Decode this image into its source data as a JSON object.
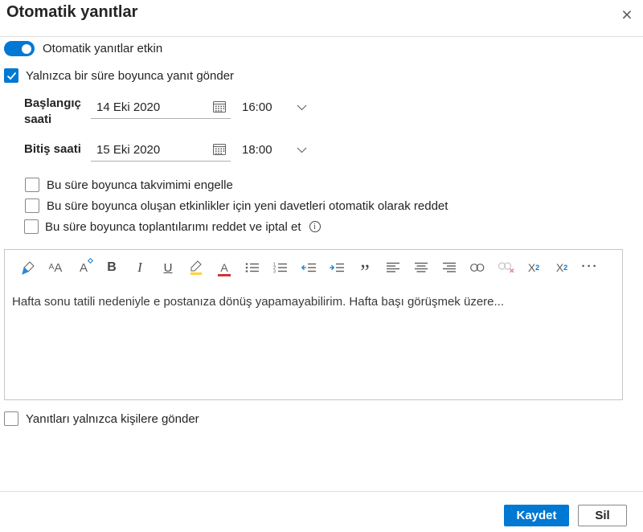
{
  "dialog": {
    "title": "Otomatik yanıtlar",
    "close_icon": "×"
  },
  "auto_reply_toggle": {
    "label": "Otomatik yanıtlar etkin",
    "state": "on"
  },
  "period_checkbox": {
    "label": "Yalnızca bir süre boyunca yanıt gönder",
    "checked": true
  },
  "schedule": {
    "start": {
      "label": "Başlangıç saati",
      "date": "14 Eki 2020",
      "time": "16:00"
    },
    "end": {
      "label": "Bitiş saati",
      "date": "15 Eki 2020",
      "time": "18:00"
    }
  },
  "options": [
    {
      "label": "Bu süre boyunca takvimimi engelle",
      "checked": false
    },
    {
      "label": "Bu süre boyunca oluşan etkinlikler için yeni davetleri otomatik olarak reddet",
      "checked": false
    },
    {
      "label": "Bu süre boyunca toplantılarımı reddet ve iptal et",
      "checked": false,
      "info": true
    }
  ],
  "editor": {
    "toolbar_icons": [
      "format-painter-icon",
      "font-name-icon",
      "font-size-icon",
      "bold-icon",
      "italic-icon",
      "underline-icon",
      "highlight-icon",
      "font-color-icon",
      "bullet-list-icon",
      "numbered-list-icon",
      "decrease-indent-icon",
      "increase-indent-icon",
      "quote-icon",
      "align-left-icon",
      "align-center-icon",
      "align-right-icon",
      "insert-link-icon",
      "remove-link-icon",
      "superscript-icon",
      "subscript-icon",
      "more-options-icon"
    ],
    "superscript_base": "X",
    "superscript_exp": "2",
    "subscript_base": "X",
    "subscript_sub": "2",
    "bold_glyph": "B",
    "italic_glyph": "I",
    "underline_glyph": "U",
    "font_color_glyph": "A",
    "font_size_glyph": "A",
    "quote_glyph": "”",
    "more_glyph": "···",
    "message": "Hafta sonu tatili nedeniyle e postanıza dönüş yapamayabilirim. Hafta başı görüşmek üzere..."
  },
  "contacts_checkbox": {
    "label": "Yanıtları yalnızca kişilere gönder",
    "checked": false
  },
  "footer": {
    "save_label": "Kaydet",
    "delete_label": "Sil"
  },
  "colors": {
    "accent": "#0078d4",
    "icon_gray": "#605e5c",
    "border_gray": "#8a8886",
    "divider": "#e1dfdd",
    "highlight_yellow": "#ffd335",
    "font_color_red": "#d13438"
  }
}
